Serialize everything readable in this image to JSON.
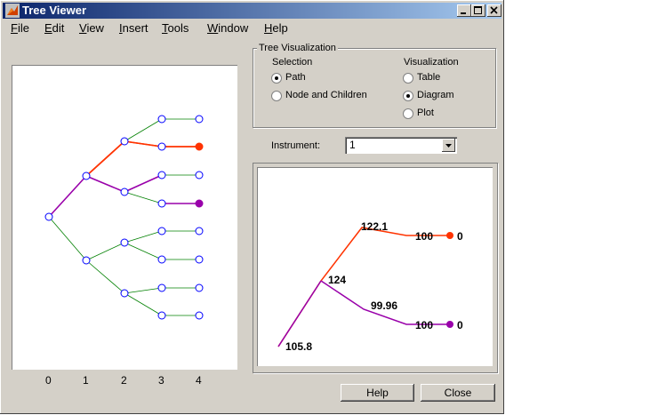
{
  "window": {
    "title": "Tree Viewer"
  },
  "menu": [
    "File",
    "Edit",
    "View",
    "Insert",
    "Tools",
    "Window",
    "Help"
  ],
  "menu_underline": [
    "F",
    "E",
    "V",
    "I",
    "T",
    "W",
    "H"
  ],
  "tree_visualization": {
    "group_label": "Tree Visualization",
    "selection_label": "Selection",
    "selection_options": [
      "Path",
      "Node and Children"
    ],
    "selection_selected": "Path",
    "visualization_label": "Visualization",
    "visualization_options": [
      "Table",
      "Diagram",
      "Plot"
    ],
    "visualization_selected": "Diagram"
  },
  "instrument": {
    "label": "Instrument:",
    "value": "1"
  },
  "tree_axis": {
    "x_ticks": [
      "0",
      "1",
      "2",
      "3",
      "4"
    ]
  },
  "diagram_labels": {
    "root": "105.8",
    "mid": "124",
    "upper_mid": "122.1",
    "lower_mid": "99.96",
    "upper_end": "100",
    "lower_end": "100",
    "upper_final": "0",
    "lower_final": "0"
  },
  "buttons": {
    "help": "Help",
    "close": "Close"
  },
  "colors": {
    "path_red": "#ff3300",
    "path_purple": "#9900aa",
    "branch_green": "#008000",
    "node_blue": "#0000ff"
  }
}
